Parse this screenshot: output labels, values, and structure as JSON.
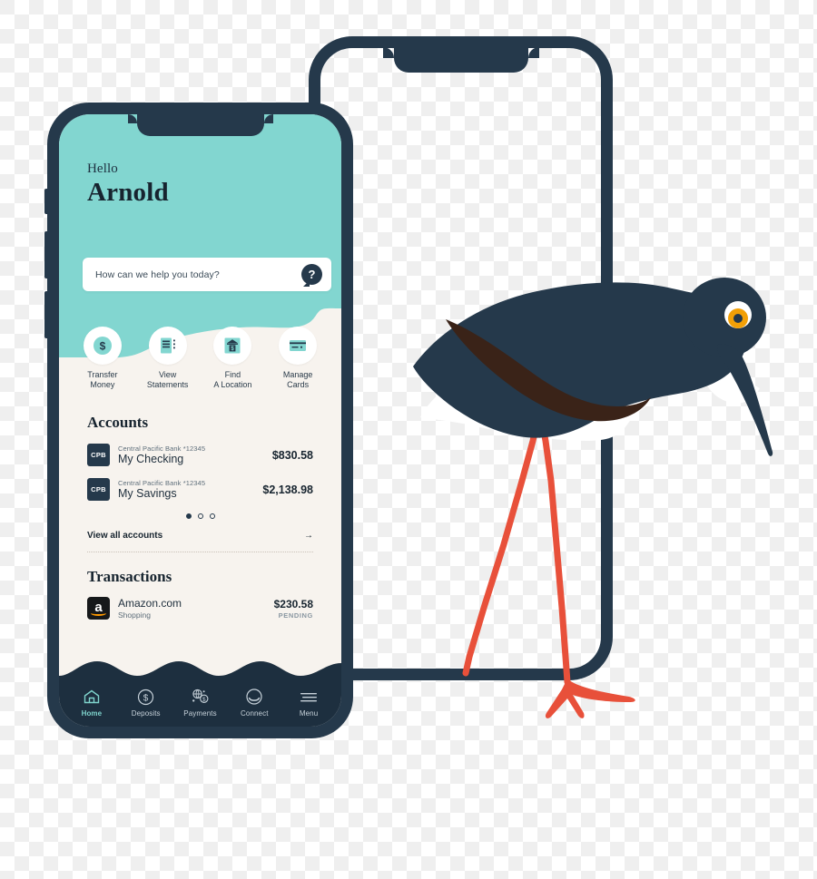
{
  "colors": {
    "teal": "#82D6D0",
    "teal_dark": "#6FC9C2",
    "navy": "#25394B",
    "navy_deep": "#17242F",
    "cream": "#F7F3EE",
    "white": "#FFFFFF",
    "accent_red": "#E8503A",
    "eye_gold": "#F2A007",
    "amazon_orange": "#FF9900"
  },
  "phone": {
    "greeting": {
      "hello": "Hello",
      "name": "Arnold"
    },
    "help": {
      "placeholder": "How can we help you today?",
      "value": "How can we help you today?",
      "button_glyph": "?",
      "button_icon": "question-speech-bubble-icon"
    },
    "quick_actions": [
      {
        "label_line1": "Transfer",
        "label_line2": "Money",
        "icon": "dollar-circle-icon"
      },
      {
        "label_line1": "View",
        "label_line2": "Statements",
        "icon": "document-lines-icon"
      },
      {
        "label_line1": "Find",
        "label_line2": "A Location",
        "icon": "bank-building-icon"
      },
      {
        "label_line1": "Manage",
        "label_line2": "Cards",
        "icon": "credit-card-icon"
      }
    ],
    "accounts": {
      "title": "Accounts",
      "items": [
        {
          "logo_text": "CPB",
          "bank": "Central Pacific Bank *12345",
          "name": "My Checking",
          "amount": "$830.58"
        },
        {
          "logo_text": "CPB",
          "bank": "Central Pacific Bank *12345",
          "name": "My Savings",
          "amount": "$2,138.98"
        }
      ],
      "pager": {
        "total": 3,
        "active_index": 0
      },
      "view_all_label": "View all accounts",
      "view_all_icon": "arrow-right-icon"
    },
    "transactions": {
      "title": "Transactions",
      "items": [
        {
          "merchant_logo": "amazon-logo-icon",
          "merchant_glyph": "a",
          "name": "Amazon.com",
          "category": "Shopping",
          "amount": "$230.58",
          "status": "PENDING"
        }
      ]
    },
    "bottom_nav": [
      {
        "label": "Home",
        "icon": "house-icon",
        "active": true
      },
      {
        "label": "Deposits",
        "icon": "dollar-circle-outline-icon",
        "active": false
      },
      {
        "label": "Payments",
        "icon": "globe-payment-icon",
        "active": false
      },
      {
        "label": "Connect",
        "icon": "connect-swoosh-icon",
        "active": false
      },
      {
        "label": "Menu",
        "icon": "hamburger-menu-icon",
        "active": false
      }
    ]
  },
  "illustration": {
    "name": "hawaiian-stilt-bird-illustration",
    "description": "Hawaiian stilt wading bird with dark navy back, white underside, orange eye, long red-orange legs"
  }
}
